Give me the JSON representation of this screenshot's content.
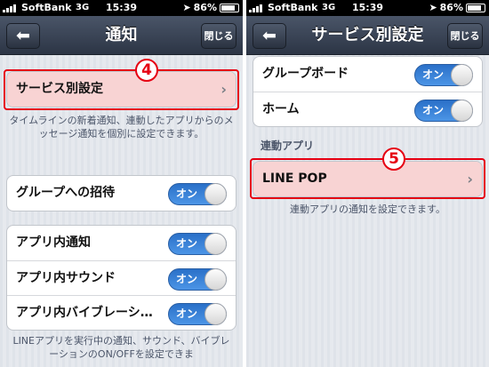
{
  "left": {
    "status": {
      "carrier": "SoftBank",
      "network": "3G",
      "time": "15:39",
      "battery": "86%"
    },
    "nav": {
      "back": "⬅",
      "title": "通知",
      "close": "閉じる"
    },
    "service_row": {
      "label": "サービス別設定",
      "chevron": "›"
    },
    "service_note": "タイムラインの新着通知、連動したアプリからのメッセージ通知を個別に設定できます。",
    "group_invite": {
      "label": "グループへの招待",
      "toggle": "オン"
    },
    "app_rows": [
      {
        "label": "アプリ内通知",
        "toggle": "オン"
      },
      {
        "label": "アプリ内サウンド",
        "toggle": "オン"
      },
      {
        "label": "アプリ内バイブレーシ…",
        "toggle": "オン"
      }
    ],
    "bottom_note": "LINEアプリを実行中の通知、サウンド、バイブレーションのON/OFFを設定できま",
    "badge": "4"
  },
  "right": {
    "status": {
      "carrier": "SoftBank",
      "network": "3G",
      "time": "15:39",
      "battery": "86%"
    },
    "nav": {
      "back": "⬅",
      "title": "サービス別設定",
      "close": "閉じる"
    },
    "rows": [
      {
        "label": "グループボード",
        "toggle": "オン"
      },
      {
        "label": "ホーム",
        "toggle": "オン"
      }
    ],
    "section_title": "連動アプリ",
    "linepop_row": {
      "label": "LINE POP",
      "chevron": "›"
    },
    "linepop_note": "連動アプリの通知を設定できます。",
    "badge": "5"
  },
  "colors": {
    "highlight_red": "#e60012",
    "toggle_blue": "#2a70c8",
    "nav_bg": "#2c3545"
  }
}
